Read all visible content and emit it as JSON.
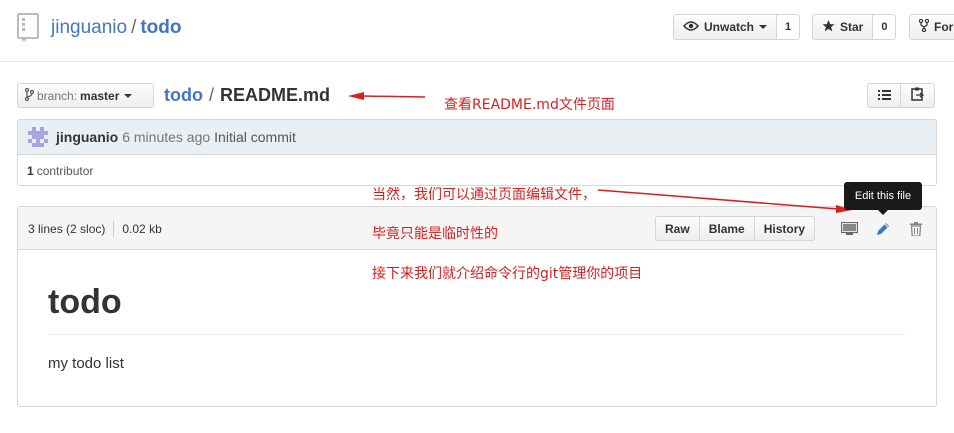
{
  "header": {
    "owner": "jinguanio",
    "separator": "/",
    "repo": "todo",
    "watch_label": "Unwatch",
    "watch_count": "1",
    "star_label": "Star",
    "star_count": "0",
    "fork_label": "Fork"
  },
  "breadcrumb": {
    "branch_label": "branch:",
    "branch_value": "master",
    "root": "todo",
    "separator": "/",
    "file": "README.md"
  },
  "commit": {
    "author": "jinguanio",
    "time": "6 minutes ago",
    "message": "Initial commit",
    "contributor_count": "1",
    "contributor_label": "contributor"
  },
  "file": {
    "lines": "3 lines (2 sloc)",
    "size": "0.02 kb",
    "raw_label": "Raw",
    "blame_label": "Blame",
    "history_label": "History",
    "tooltip": "Edit this file"
  },
  "readme": {
    "heading": "todo",
    "body": "my todo list"
  },
  "annotations": {
    "note1": "查看README.md文件页面",
    "note2": "当然，我们可以通过页面编辑文件，",
    "note3": "毕竟只能是临时性的",
    "note4": "接下来我们就介绍命令行的git管理你的项目",
    "color": "#d62020"
  },
  "icons": {
    "repo": "repo-icon",
    "eye": "eye-icon",
    "star": "star-icon",
    "fork": "fork-icon",
    "branch": "branch-icon",
    "list": "list-icon",
    "clipboard": "clipboard-icon",
    "desktop": "desktop-icon",
    "pencil": "pencil-icon",
    "trash": "trash-icon"
  }
}
